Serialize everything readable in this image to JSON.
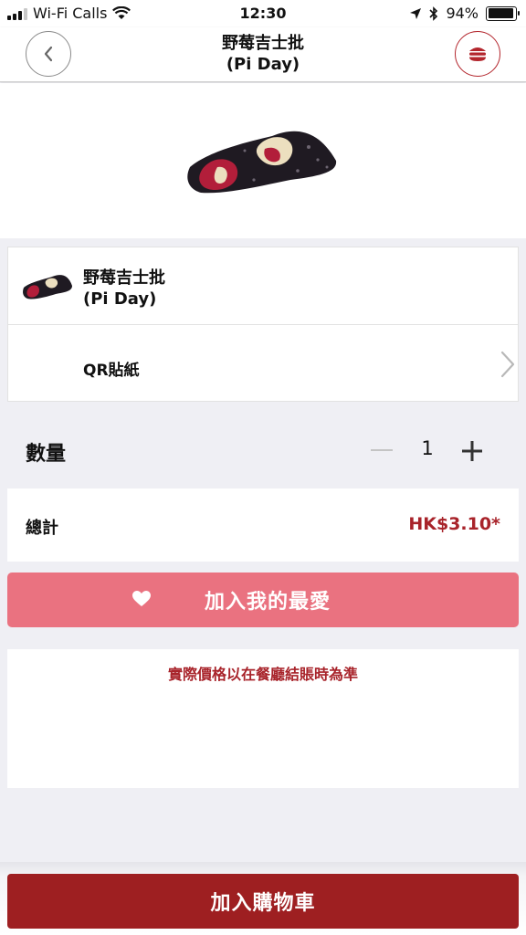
{
  "status_bar": {
    "carrier": "Wi-Fi Calls",
    "time": "12:30",
    "battery_percent": "94%",
    "battery_level": 0.94,
    "icons": [
      "signal-icon",
      "wifi-icon",
      "location-arrow-icon",
      "bluetooth-icon",
      "battery-icon"
    ]
  },
  "nav": {
    "title_line1": "野莓吉士批",
    "title_line2": "(Pi Day)",
    "back_icon": "chevron-left-icon",
    "menu_icon": "burger-icon"
  },
  "item": {
    "name_line1": "野莓吉士批",
    "name_line2": "(Pi Day)",
    "option_label": "QR貼紙"
  },
  "quantity": {
    "label": "數量",
    "value": "1",
    "minus_symbol": "—",
    "plus_symbol": "+"
  },
  "total": {
    "label": "總計",
    "price": "HK$3.10*"
  },
  "favourite": {
    "label": "加入我的最愛",
    "icon": "heart-icon"
  },
  "note": {
    "text": "實際價格以在餐廳結賬時為準"
  },
  "cart": {
    "label": "加入購物車"
  },
  "colors": {
    "brand_red": "#9e1f21",
    "price_red": "#a8232a",
    "favourite_pink": "#ea7280",
    "background": "#efeff4"
  }
}
